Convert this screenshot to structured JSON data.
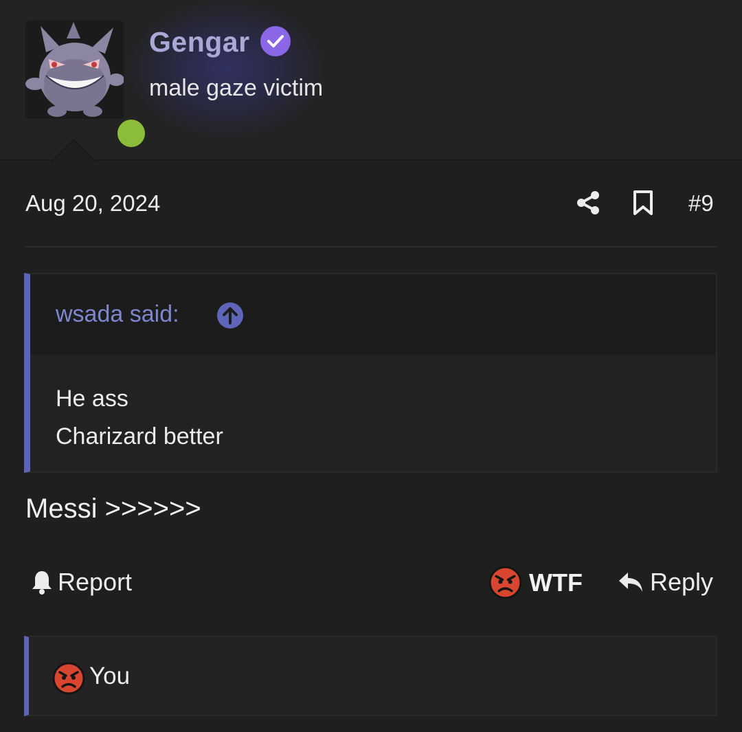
{
  "user": {
    "username": "Gengar",
    "user_title": "male gaze victim",
    "verified": true,
    "online": true,
    "avatar_icon": "gengar-avatar-icon"
  },
  "post": {
    "date": "Aug 20, 2024",
    "number": "#9",
    "share_icon": "share-icon",
    "bookmark_icon": "bookmark-icon",
    "quote": {
      "author_label": "wsada said:",
      "lines": [
        "He ass",
        "Charizard better"
      ]
    },
    "body": "Messi >>>>>>"
  },
  "actions": {
    "report_label": "Report",
    "reaction_label": "WTF",
    "reply_label": "Reply"
  },
  "reactions": {
    "summary_user": "You",
    "icon": "angry-face-icon"
  },
  "colors": {
    "accent": "#5c65b8",
    "username": "#a9a9d8",
    "verified_badge": "#8b67e8",
    "online": "#8bbd3a",
    "background": "#1f1f20"
  }
}
